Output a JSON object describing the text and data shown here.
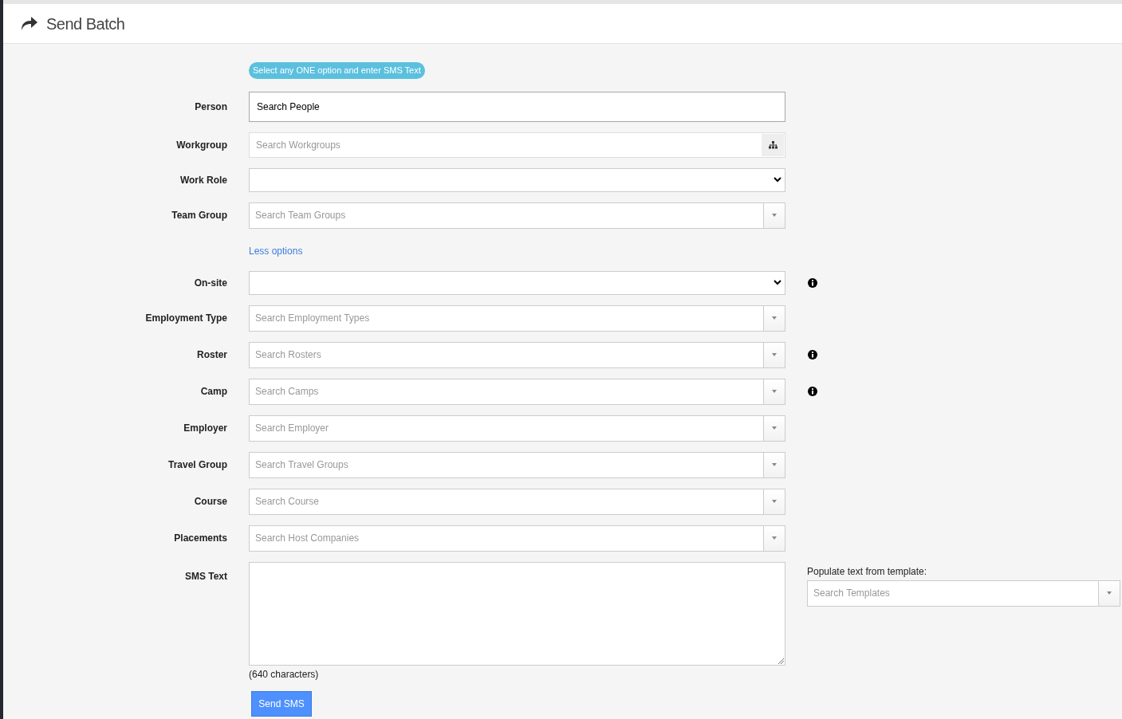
{
  "header": {
    "title": "Send Batch"
  },
  "hint_badge": "Select any ONE option and enter SMS Text",
  "fields_top": [
    {
      "label": "Person",
      "kind": "text",
      "value": "Search People",
      "info": false
    },
    {
      "label": "Workgroup",
      "kind": "search-button",
      "placeholder": "Search Workgroups",
      "info": false
    },
    {
      "label": "Work Role",
      "kind": "select",
      "info": false
    },
    {
      "label": "Team Group",
      "kind": "combo",
      "placeholder": "Search Team Groups",
      "info": false
    }
  ],
  "toggle_link": "Less options",
  "fields_more": [
    {
      "label": "On-site",
      "kind": "select",
      "info": true
    },
    {
      "label": "Employment Type",
      "kind": "combo",
      "placeholder": "Search Employment Types",
      "info": false
    },
    {
      "label": "Roster",
      "kind": "combo",
      "placeholder": "Search Rosters",
      "info": true
    },
    {
      "label": "Camp",
      "kind": "combo",
      "placeholder": "Search Camps",
      "info": true
    },
    {
      "label": "Employer",
      "kind": "combo",
      "placeholder": "Search Employer",
      "info": false
    },
    {
      "label": "Travel Group",
      "kind": "combo",
      "placeholder": "Search Travel Groups",
      "info": false
    },
    {
      "label": "Course",
      "kind": "combo",
      "placeholder": "Search Course",
      "info": false
    },
    {
      "label": "Placements",
      "kind": "combo",
      "placeholder": "Search Host Companies",
      "info": false
    }
  ],
  "sms": {
    "label": "SMS Text",
    "counter": "(640 characters)",
    "template_label": "Populate text from template:",
    "template_placeholder": "Search Templates"
  },
  "submit": "Send SMS"
}
